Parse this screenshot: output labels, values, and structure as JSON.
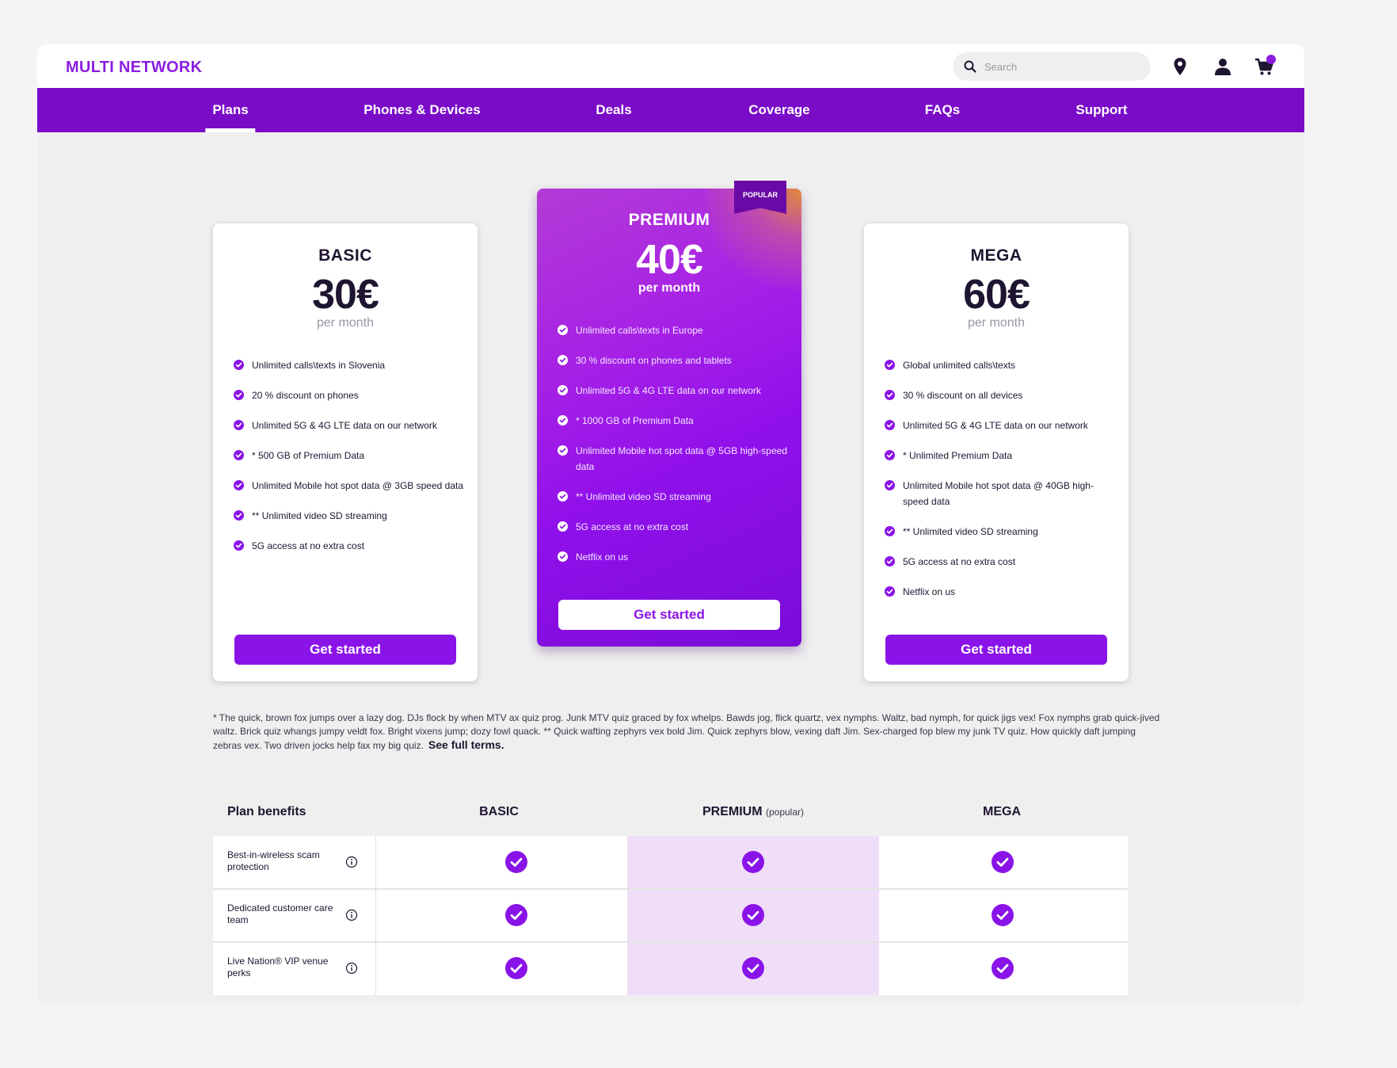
{
  "header": {
    "logo": "MULTI NETWORK",
    "search_placeholder": "Search",
    "icons": {
      "search": "search-icon",
      "location": "location-pin-icon",
      "account": "user-icon",
      "cart": "shopping-cart-icon"
    }
  },
  "nav": {
    "items": [
      {
        "label": "Plans",
        "active": true
      },
      {
        "label": "Phones & Devices",
        "active": false
      },
      {
        "label": "Deals",
        "active": false
      },
      {
        "label": "Coverage",
        "active": false
      },
      {
        "label": "FAQs",
        "active": false
      },
      {
        "label": "Support",
        "active": false
      }
    ]
  },
  "colors": {
    "brand": "#7a0cc8",
    "button": "#8a14e8",
    "premium_highlight": "#f0def9"
  },
  "plans": {
    "basic": {
      "name": "BASIC",
      "price": "30€",
      "period": "per month",
      "features": [
        "Unlimited calls\\texts in Slovenia",
        "20 % discount on phones",
        "Unlimited 5G & 4G LTE data on our network",
        "* 500 GB of Premium Data",
        "Unlimited Mobile hot spot data @ 3GB speed data",
        "** Unlimited video SD streaming",
        "5G access at no extra cost"
      ],
      "cta": "Get started"
    },
    "premium": {
      "name": "PREMIUM",
      "price": "40€",
      "period": "per month",
      "badge": "POPULAR",
      "features": [
        "Unlimited calls\\texts in Europe",
        "30 % discount on phones and tablets",
        "Unlimited 5G & 4G LTE data on our network",
        "* 1000 GB of Premium Data",
        "Unlimited Mobile hot spot data @ 5GB high-speed data",
        "** Unlimited video SD streaming",
        "5G access at no extra cost",
        "Netflix on us"
      ],
      "cta": "Get started"
    },
    "mega": {
      "name": "MEGA",
      "price": "60€",
      "period": "per month",
      "features": [
        "Global unlimited calls\\texts",
        "30 % discount on all devices",
        "Unlimited 5G & 4G LTE data on our network",
        "* Unlimited Premium Data",
        "Unlimited Mobile hot spot data @ 40GB high-speed data",
        "** Unlimited video SD streaming",
        "5G access at no extra cost",
        "Netflix on us"
      ],
      "cta": "Get started"
    }
  },
  "disclaimer": {
    "text": "* The quick, brown fox jumps over a lazy dog. DJs flock by when MTV ax quiz prog. Junk MTV quiz graced by fox whelps. Bawds jog, flick quartz, vex nymphs. Waltz, bad nymph, for quick jigs vex! Fox nymphs grab quick-jived waltz. Brick quiz whangs jumpy veldt fox. Bright vixens jump; dozy fowl quack. ** Quick wafting zephyrs vex bold Jim. Quick zephyrs blow, vexing daft Jim. Sex-charged fop blew my junk TV quiz. How quickly daft jumping zebras vex. Two driven jocks help fax my big quiz.",
    "link": "See full terms."
  },
  "comparison": {
    "header_label": "Plan benefits",
    "col_basic": "BASIC",
    "col_premium": "PREMIUM",
    "col_premium_note": "(popular)",
    "col_mega": "MEGA",
    "rows": [
      {
        "label": "Best-in-wireless scam protection",
        "basic": true,
        "premium": true,
        "mega": true
      },
      {
        "label": "Dedicated customer care team",
        "basic": true,
        "premium": true,
        "mega": true
      },
      {
        "label": "Live Nation® VIP venue perks",
        "basic": true,
        "premium": true,
        "mega": true
      }
    ]
  }
}
